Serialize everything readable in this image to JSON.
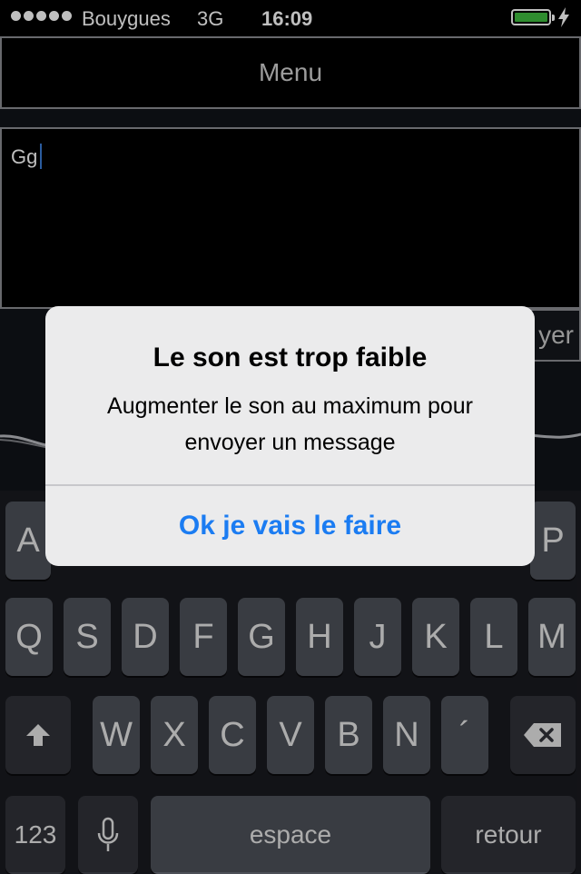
{
  "status": {
    "carrier": "Bouygues",
    "network": "3G",
    "time": "16:09",
    "battery_level": 1.0,
    "battery_color": "#3fbd3f"
  },
  "header": {
    "menu_label": "Menu"
  },
  "composer": {
    "text": "Gg",
    "send_label": "yer"
  },
  "alert": {
    "title": "Le son est trop faible",
    "message": "Augmenter le son au maximum pour envoyer un message",
    "button": "Ok je vais le faire",
    "button_color": "#1b7cf2"
  },
  "keyboard": {
    "row1_visible": [
      "A",
      "P"
    ],
    "row2": [
      "Q",
      "S",
      "D",
      "F",
      "G",
      "H",
      "J",
      "K",
      "L",
      "M"
    ],
    "row3": [
      "W",
      "X",
      "C",
      "V",
      "B",
      "N",
      "´"
    ],
    "shift_icon": "shift-icon",
    "delete_icon": "delete-icon",
    "mic_icon": "microphone-icon",
    "numbers_label": "123",
    "space_label": "espace",
    "return_label": "retour"
  }
}
